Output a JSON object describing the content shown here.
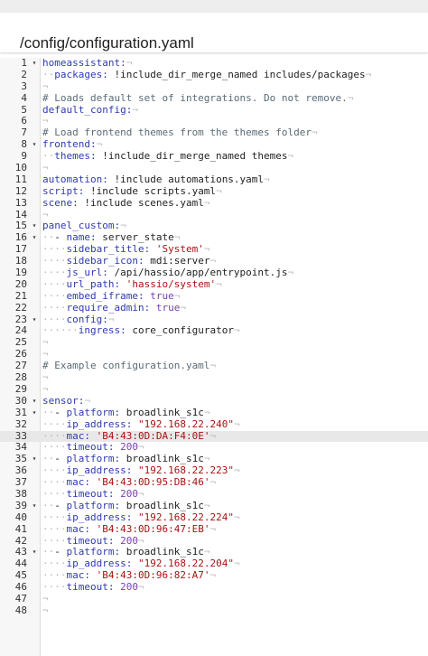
{
  "header": {
    "file_path": "/config/configuration.yaml"
  },
  "editor": {
    "active_line": 33,
    "lines": [
      {
        "n": "1",
        "fold": true,
        "indent": 0,
        "key": "homeassistant:"
      },
      {
        "n": "2",
        "indent": 2,
        "key": "packages:",
        "val": " !include_dir_merge_named includes/packages"
      },
      {
        "n": "3",
        "indent": 0
      },
      {
        "n": "4",
        "indent": 0,
        "cmt": "# Loads default set of integrations. Do not remove."
      },
      {
        "n": "5",
        "indent": 0,
        "key": "default_config:"
      },
      {
        "n": "6",
        "indent": 0
      },
      {
        "n": "7",
        "indent": 0,
        "cmt": "# Load frontend themes from the themes folder"
      },
      {
        "n": "8",
        "fold": true,
        "indent": 0,
        "key": "frontend:"
      },
      {
        "n": "9",
        "indent": 2,
        "key": "themes:",
        "val": " !include_dir_merge_named themes"
      },
      {
        "n": "10",
        "indent": 0
      },
      {
        "n": "11",
        "indent": 0,
        "key": "automation:",
        "val": " !include automations.yaml"
      },
      {
        "n": "12",
        "indent": 0,
        "key": "script:",
        "val": " !include scripts.yaml"
      },
      {
        "n": "13",
        "indent": 0,
        "key": "scene:",
        "val": " !include scenes.yaml"
      },
      {
        "n": "14",
        "indent": 0
      },
      {
        "n": "15",
        "fold": true,
        "indent": 0,
        "key": "panel_custom:"
      },
      {
        "n": "16",
        "fold": true,
        "indent": 2,
        "dash": true,
        "key": "name:",
        "val": " server_state"
      },
      {
        "n": "17",
        "indent": 4,
        "key": "sidebar_title:",
        "str": " 'System'"
      },
      {
        "n": "18",
        "indent": 4,
        "key": "sidebar_icon:",
        "val": " mdi:server"
      },
      {
        "n": "19",
        "indent": 4,
        "key": "js_url:",
        "val": " /api/hassio/app/entrypoint.js"
      },
      {
        "n": "20",
        "indent": 4,
        "key": "url_path:",
        "str": " 'hassio/system'"
      },
      {
        "n": "21",
        "indent": 4,
        "key": "embed_iframe:",
        "lit": " true"
      },
      {
        "n": "22",
        "indent": 4,
        "key": "require_admin:",
        "lit": " true"
      },
      {
        "n": "23",
        "fold": true,
        "indent": 4,
        "key": "config:"
      },
      {
        "n": "24",
        "indent": 6,
        "key": "ingress:",
        "val": " core_configurator"
      },
      {
        "n": "25",
        "indent": 0
      },
      {
        "n": "26",
        "indent": 0
      },
      {
        "n": "27",
        "indent": 0,
        "cmt": "# Example configuration.yaml"
      },
      {
        "n": "28",
        "indent": 0
      },
      {
        "n": "29",
        "indent": 0
      },
      {
        "n": "30",
        "fold": true,
        "indent": 0,
        "key": "sensor:"
      },
      {
        "n": "31",
        "fold": true,
        "indent": 2,
        "dash": true,
        "key": "platform:",
        "val": " broadlink_s1c"
      },
      {
        "n": "32",
        "indent": 4,
        "key": "ip_address:",
        "str": " \"192.168.22.240\""
      },
      {
        "n": "33",
        "indent": 4,
        "key": "mac:",
        "str": " 'B4:43:0D:DA:F4:0E'"
      },
      {
        "n": "34",
        "indent": 4,
        "key": "timeout:",
        "lit": " 200"
      },
      {
        "n": "35",
        "fold": true,
        "indent": 2,
        "dash": true,
        "key": "platform:",
        "val": " broadlink_s1c"
      },
      {
        "n": "36",
        "indent": 4,
        "key": "ip_address:",
        "str": " \"192.168.22.223\""
      },
      {
        "n": "37",
        "indent": 4,
        "key": "mac:",
        "str": " 'B4:43:0D:95:DB:46'"
      },
      {
        "n": "38",
        "indent": 4,
        "key": "timeout:",
        "lit": " 200"
      },
      {
        "n": "39",
        "fold": true,
        "indent": 2,
        "dash": true,
        "key": "platform:",
        "val": " broadlink_s1c"
      },
      {
        "n": "40",
        "indent": 4,
        "key": "ip_address:",
        "str": " \"192.168.22.224\""
      },
      {
        "n": "41",
        "indent": 4,
        "key": "mac:",
        "str": " 'B4:43:0D:96:47:EB'"
      },
      {
        "n": "42",
        "indent": 4,
        "key": "timeout:",
        "lit": " 200"
      },
      {
        "n": "43",
        "fold": true,
        "indent": 2,
        "dash": true,
        "key": "platform:",
        "val": " broadlink_s1c"
      },
      {
        "n": "44",
        "indent": 4,
        "key": "ip_address:",
        "str": " \"192.168.22.204\""
      },
      {
        "n": "45",
        "indent": 4,
        "key": "mac:",
        "str": " 'B4:43:0D:96:82:A7'"
      },
      {
        "n": "46",
        "indent": 4,
        "key": "timeout:",
        "lit": " 200"
      },
      {
        "n": "47",
        "indent": 0
      },
      {
        "n": "48",
        "indent": 0
      }
    ]
  }
}
